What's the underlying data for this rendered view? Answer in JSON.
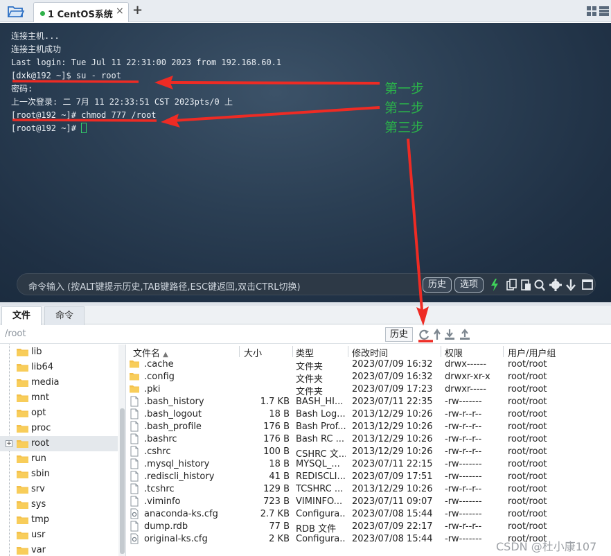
{
  "tabbar": {
    "session_tab_title": "1 CentOS系统",
    "close_glyph": "×",
    "add_glyph": "+"
  },
  "terminal": {
    "lines": [
      "连接主机...",
      "连接主机成功",
      "Last login: Tue Jul 11 22:31:00 2023 from 192.168.60.1",
      "[dxk@192 ~]$ su - root",
      "密码:",
      "上一次登录: 二 7月 11 22:33:51 CST 2023pts/0 上",
      "[root@192 ~]# chmod 777 /root",
      "[root@192 ~]# "
    ],
    "annotations": [
      "第一步",
      "第二步",
      "第三步"
    ],
    "annotation_color": "#2bb24a",
    "arrow_color": "#ee2b24"
  },
  "command_bar": {
    "placeholder": "命令输入 (按ALT键提示历史,TAB键路径,ESC键返回,双击CTRL切换)",
    "history_button": "历史",
    "options_button": "选项",
    "icons": [
      "lightning-icon",
      "copy-icon",
      "paste-icon",
      "search-icon",
      "gear-icon",
      "download-icon",
      "window-icon"
    ]
  },
  "panel": {
    "tabs": [
      "文件",
      "命令"
    ],
    "active_tab": "文件",
    "path": "/root",
    "history_button": "历史",
    "icons": [
      "refresh-icon",
      "up-icon",
      "download-icon",
      "upload-icon"
    ]
  },
  "tree": {
    "items": [
      "lib",
      "lib64",
      "media",
      "mnt",
      "opt",
      "proc",
      "root",
      "run",
      "sbin",
      "srv",
      "sys",
      "tmp",
      "usr",
      "var"
    ],
    "selected": "root"
  },
  "files": {
    "columns": [
      "文件名",
      "大小",
      "类型",
      "修改时间",
      "权限",
      "用户/用户组"
    ],
    "rows": [
      {
        "name": ".cache",
        "size": "",
        "type": "文件夹",
        "mtime": "2023/07/09 16:32",
        "perm": "drwx------",
        "owner": "root/root",
        "kind": "folder"
      },
      {
        "name": ".config",
        "size": "",
        "type": "文件夹",
        "mtime": "2023/07/09 16:32",
        "perm": "drwxr-xr-x",
        "owner": "root/root",
        "kind": "folder"
      },
      {
        "name": ".pki",
        "size": "",
        "type": "文件夹",
        "mtime": "2023/07/09 17:23",
        "perm": "drwxr-----",
        "owner": "root/root",
        "kind": "folder"
      },
      {
        "name": ".bash_history",
        "size": "1.7 KB",
        "type": "BASH_HI...",
        "mtime": "2023/07/11 22:35",
        "perm": "-rw-------",
        "owner": "root/root",
        "kind": "file"
      },
      {
        "name": ".bash_logout",
        "size": "18 B",
        "type": "Bash Log...",
        "mtime": "2013/12/29 10:26",
        "perm": "-rw-r--r--",
        "owner": "root/root",
        "kind": "file"
      },
      {
        "name": ".bash_profile",
        "size": "176 B",
        "type": "Bash Prof...",
        "mtime": "2013/12/29 10:26",
        "perm": "-rw-r--r--",
        "owner": "root/root",
        "kind": "file"
      },
      {
        "name": ".bashrc",
        "size": "176 B",
        "type": "Bash RC ...",
        "mtime": "2013/12/29 10:26",
        "perm": "-rw-r--r--",
        "owner": "root/root",
        "kind": "file"
      },
      {
        "name": ".cshrc",
        "size": "100 B",
        "type": "CSHRC 文...",
        "mtime": "2013/12/29 10:26",
        "perm": "-rw-r--r--",
        "owner": "root/root",
        "kind": "file"
      },
      {
        "name": ".mysql_history",
        "size": "18 B",
        "type": "MYSQL_...",
        "mtime": "2023/07/11 22:15",
        "perm": "-rw-------",
        "owner": "root/root",
        "kind": "file"
      },
      {
        "name": ".rediscli_history",
        "size": "41 B",
        "type": "REDISCLI...",
        "mtime": "2023/07/09 17:51",
        "perm": "-rw-------",
        "owner": "root/root",
        "kind": "file"
      },
      {
        "name": ".tcshrc",
        "size": "129 B",
        "type": "TCSHRC ...",
        "mtime": "2013/12/29 10:26",
        "perm": "-rw-r--r--",
        "owner": "root/root",
        "kind": "file"
      },
      {
        "name": ".viminfo",
        "size": "723 B",
        "type": "VIMINFO...",
        "mtime": "2023/07/11 09:07",
        "perm": "-rw-------",
        "owner": "root/root",
        "kind": "file"
      },
      {
        "name": "anaconda-ks.cfg",
        "size": "2.7 KB",
        "type": "Configura...",
        "mtime": "2023/07/08 15:44",
        "perm": "-rw-------",
        "owner": "root/root",
        "kind": "config"
      },
      {
        "name": "dump.rdb",
        "size": "77 B",
        "type": "RDB 文件",
        "mtime": "2023/07/09 22:17",
        "perm": "-rw-r--r--",
        "owner": "root/root",
        "kind": "file"
      },
      {
        "name": "original-ks.cfg",
        "size": "2 KB",
        "type": "Configura...",
        "mtime": "2023/07/08 15:44",
        "perm": "-rw-------",
        "owner": "root/root",
        "kind": "config"
      }
    ]
  },
  "watermark": "CSDN @杜小康107"
}
